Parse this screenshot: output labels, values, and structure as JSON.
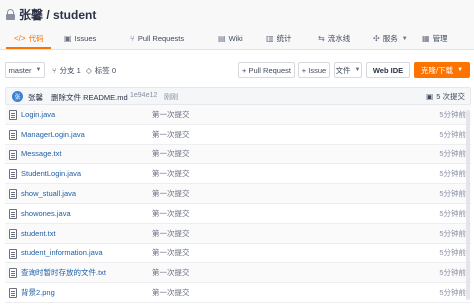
{
  "repo": {
    "title": "张馨 / student"
  },
  "tabs": [
    {
      "label": "代码",
      "icon": "code-icon"
    },
    {
      "label": "Issues",
      "icon": "issues-icon"
    },
    {
      "label": "Pull Requests",
      "icon": "pull-request-icon"
    },
    {
      "label": "Wiki",
      "icon": "wiki-icon"
    },
    {
      "label": "统计",
      "icon": "stats-icon"
    },
    {
      "label": "流水线",
      "icon": "pipeline-icon"
    },
    {
      "label": "服务",
      "icon": "service-icon"
    },
    {
      "label": "管理",
      "icon": "settings-icon"
    }
  ],
  "toolbar": {
    "branch": "master",
    "branches": "分支 1",
    "tags": "标签 0",
    "pull_request": "+ Pull Request",
    "issue": "+ Issue",
    "file": "文件",
    "web_ide": "Web IDE",
    "clone": "克隆/下载"
  },
  "commit": {
    "avatar_letter": "张",
    "author": "张馨",
    "message": "删除文件 README.md",
    "hash": "1e94e12",
    "time": "刚刚",
    "count": "5 次提交"
  },
  "files": [
    {
      "name": "Login.java",
      "message": "第一次提交",
      "time": "5分钟前"
    },
    {
      "name": "ManagerLogin.java",
      "message": "第一次提交",
      "time": "5分钟前"
    },
    {
      "name": "Message.txt",
      "message": "第一次提交",
      "time": "5分钟前"
    },
    {
      "name": "StudentLogin.java",
      "message": "第一次提交",
      "time": "5分钟前"
    },
    {
      "name": "show_stuall.java",
      "message": "第一次提交",
      "time": "5分钟前"
    },
    {
      "name": "showones.java",
      "message": "第一次提交",
      "time": "5分钟前"
    },
    {
      "name": "student.txt",
      "message": "第一次提交",
      "time": "5分钟前"
    },
    {
      "name": "student_information.java",
      "message": "第一次提交",
      "time": "5分钟前"
    },
    {
      "name": "查询时暂时存放的文件.txt",
      "message": "第一次提交",
      "time": "5分钟前"
    },
    {
      "name": "背景2.png",
      "message": "第一次提交",
      "time": "5分钟前"
    }
  ],
  "colors": {
    "accent": "#fe7300",
    "link": "#1d5ea7"
  }
}
